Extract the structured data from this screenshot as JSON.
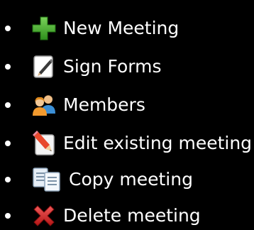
{
  "menu": {
    "items": [
      {
        "label": "New Meeting",
        "icon": "plus-icon"
      },
      {
        "label": "Sign Forms",
        "icon": "pen-sign-icon"
      },
      {
        "label": "Members",
        "icon": "members-icon"
      },
      {
        "label": "Edit existing meeting",
        "icon": "edit-pencil-icon"
      },
      {
        "label": "Copy meeting",
        "icon": "copy-documents-icon"
      },
      {
        "label": "Delete meeting",
        "icon": "delete-x-icon"
      }
    ]
  },
  "colors": {
    "background": "#000000",
    "text": "#ffffff",
    "plus": "#3fae2a",
    "delete": "#d42020"
  }
}
